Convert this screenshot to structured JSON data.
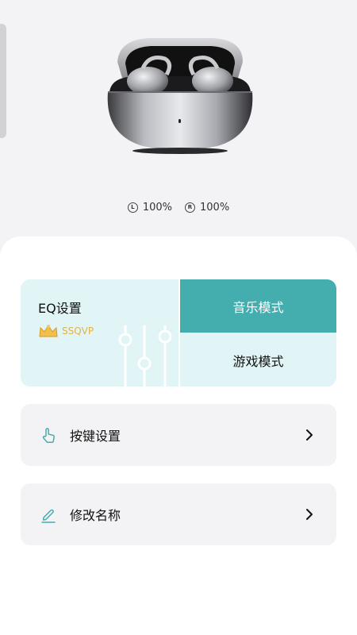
{
  "battery": {
    "left_badge": "L",
    "left_value": "100%",
    "right_badge": "R",
    "right_value": "100%"
  },
  "eq": {
    "title": "EQ设置",
    "vip_label": "SSQVP",
    "modes": [
      {
        "label": "音乐模式",
        "selected": true
      },
      {
        "label": "游戏模式",
        "selected": false
      }
    ]
  },
  "settings": {
    "key_settings_label": "按键设置",
    "rename_label": "修改名称"
  },
  "colors": {
    "accent": "#44adad",
    "eq_background": "#e1f4f6",
    "vip_gold": "#e0b34a"
  },
  "icons": {
    "key_settings": "tap-hand-icon",
    "rename": "pen-icon",
    "chevron": "chevron-right-icon"
  }
}
